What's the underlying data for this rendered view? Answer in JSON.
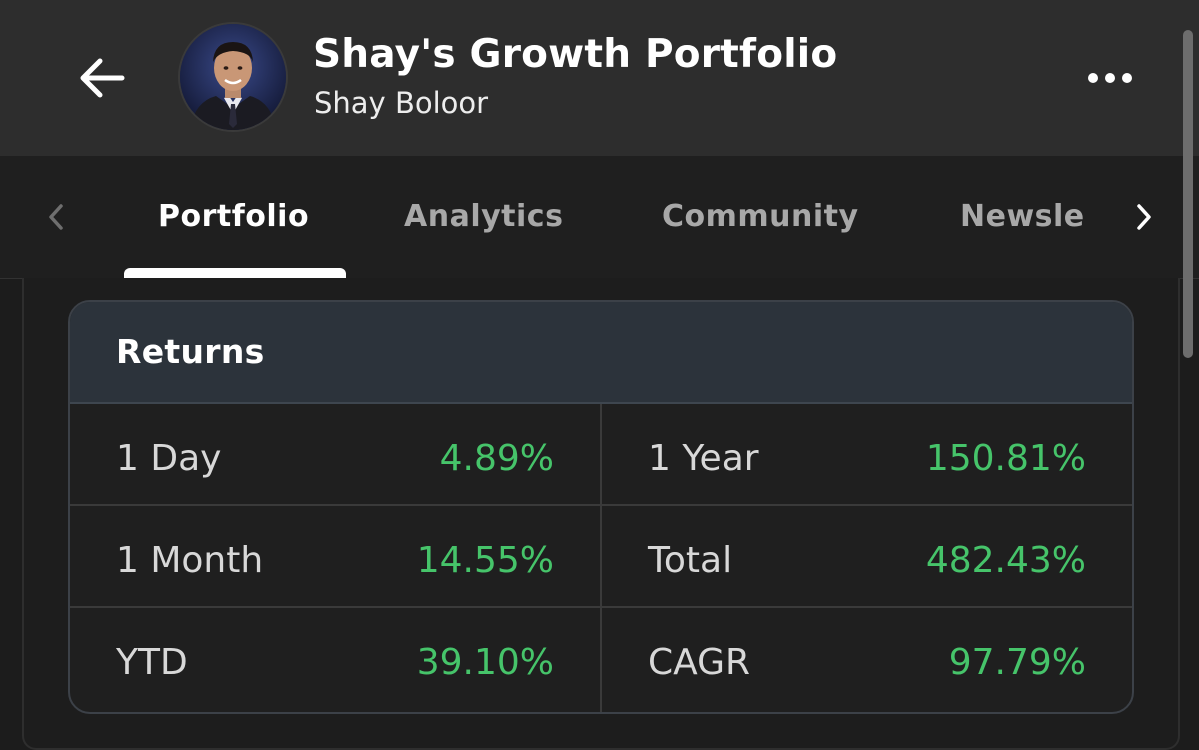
{
  "header": {
    "title": "Shay's Growth Portfolio",
    "subtitle": "Shay Boloor",
    "back_icon": "arrow-left-icon",
    "more_icon": "more-horizontal-icon"
  },
  "tabs": {
    "prev_icon": "chevron-left-icon",
    "next_icon": "chevron-right-icon",
    "items": [
      {
        "label": "Portfolio",
        "active": true
      },
      {
        "label": "Analytics",
        "active": false
      },
      {
        "label": "Community",
        "active": false
      },
      {
        "label": "Newsle",
        "active": false
      }
    ]
  },
  "returns": {
    "title": "Returns",
    "rows": [
      {
        "left_label": "1 Day",
        "left_value": "4.89%",
        "right_label": "1 Year",
        "right_value": "150.81%"
      },
      {
        "left_label": "1 Month",
        "left_value": "14.55%",
        "right_label": "Total",
        "right_value": "482.43%"
      },
      {
        "left_label": "YTD",
        "left_value": "39.10%",
        "right_label": "CAGR",
        "right_value": "97.79%"
      }
    ]
  },
  "colors": {
    "positive": "#46c46a",
    "header_bg": "#2d2d2d",
    "card_header_bg": "#2c333b"
  }
}
